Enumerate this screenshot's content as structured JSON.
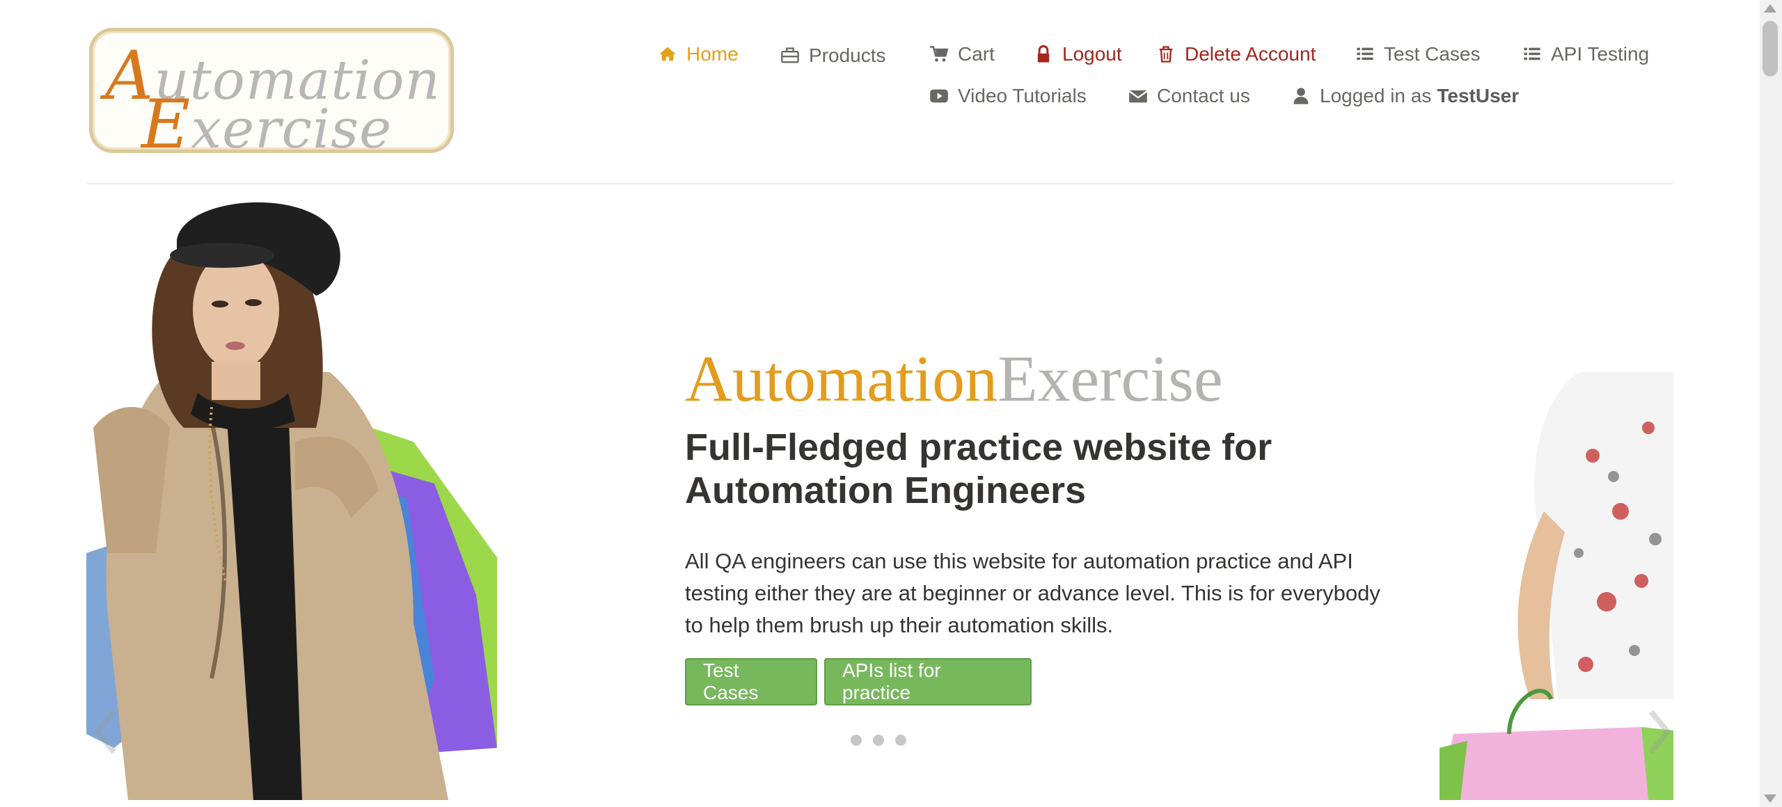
{
  "logo": {
    "line1_cap": "A",
    "line1_rest": "utomation",
    "line2_cap": "E",
    "line2_rest": "xercise"
  },
  "nav": {
    "home": "Home",
    "products": "Products",
    "cart": "Cart",
    "logout": "Logout",
    "delete_account": "Delete Account",
    "test_cases": "Test Cases",
    "api_testing": "API Testing",
    "video_tutorials": "Video Tutorials",
    "contact_us": "Contact us",
    "logged_in_prefix": "Logged in as",
    "username": "TestUser"
  },
  "hero": {
    "brand_part1": "Automation",
    "brand_part2": "Exercise",
    "heading": "Full-Fledged practice website for Automation Engineers",
    "description": "All QA engineers can use this website for automation practice and API testing either they are at beginner or advance level. This is for everybody to help them brush up their automation skills.",
    "button_test_cases": "Test Cases",
    "button_apis": "APIs list for practice"
  },
  "colors": {
    "accent_orange": "#e39c1c",
    "danger_red": "#a6251d",
    "button_green": "#78b85d",
    "text_gray": "#696763"
  },
  "icons": {
    "home": "home-icon",
    "products": "briefcase-icon",
    "cart": "cart-icon",
    "logout": "lock-icon",
    "delete": "trash-icon",
    "list": "list-icon",
    "video": "youtube-play-icon",
    "contact": "envelope-icon",
    "user": "user-icon"
  }
}
